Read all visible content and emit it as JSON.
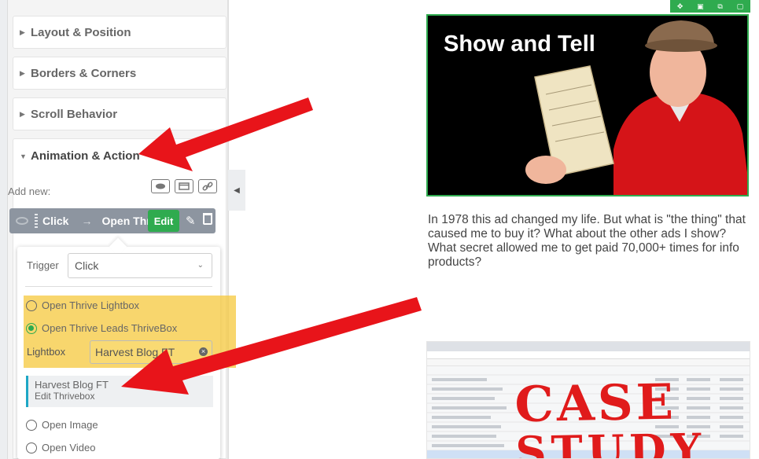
{
  "sidebar": {
    "sections": [
      {
        "label": "Layout & Position"
      },
      {
        "label": "Borders & Corners"
      },
      {
        "label": "Scroll Behavior"
      },
      {
        "label": "Animation & Action"
      }
    ],
    "add_new_label": "Add new:",
    "action": {
      "trigger": "Click",
      "target": "Open Thrive Lightbox",
      "edit_label": "Edit"
    }
  },
  "popover": {
    "trigger_label": "Trigger",
    "trigger_value": "Click",
    "options": [
      {
        "label": "Open Thrive Lightbox",
        "checked": false
      },
      {
        "label": "Open Thrive Leads ThriveBox",
        "checked": true
      },
      {
        "label": "Open Image",
        "checked": false
      },
      {
        "label": "Open Video",
        "checked": false
      }
    ],
    "lightbox_label": "Lightbox",
    "lightbox_value": "Harvest Blog FT",
    "suggestion": {
      "title": "Harvest Blog FT",
      "subtitle": "Edit Thrivebox"
    }
  },
  "content": {
    "hero_title": "Show and Tell",
    "paragraph": "In 1978 this ad changed my life.  But what is \"the thing\" that caused me to buy it?  What about the other ads I show?  What secret allowed me to get paid 70,000+ times for info products?",
    "case_study_line1": "CASE",
    "case_study_line2": "STUDY"
  },
  "colors": {
    "accent_green": "#2fab4f",
    "annotation_red": "#e8141a",
    "highlight_yellow": "#f5c83c",
    "suggestion_border": "#1ea7c5"
  }
}
